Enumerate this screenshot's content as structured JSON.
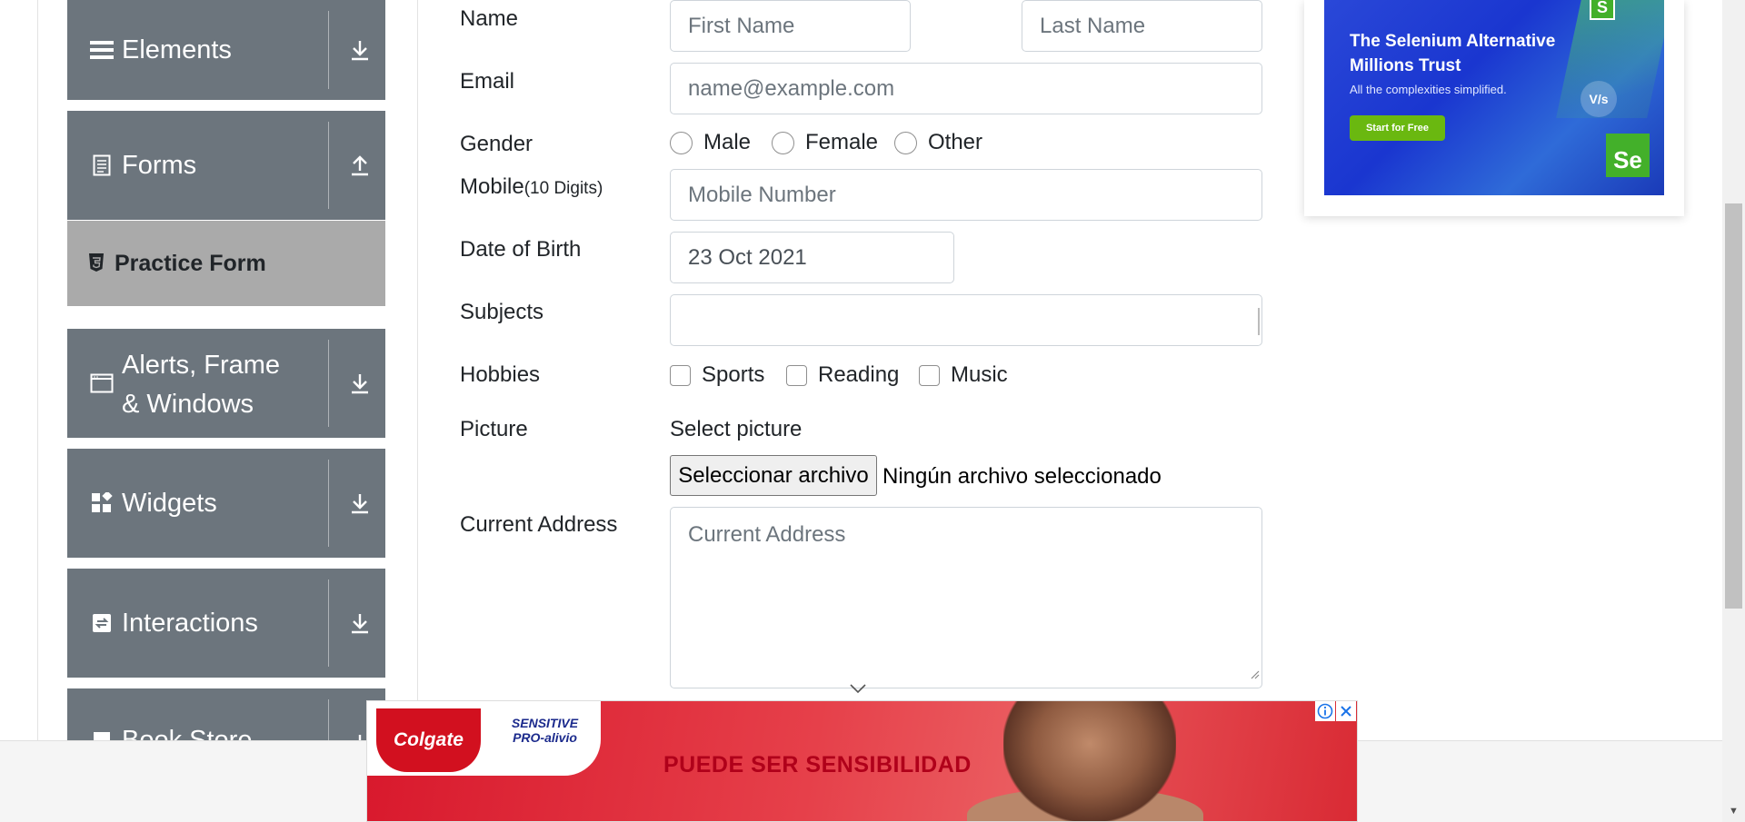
{
  "sidebar": {
    "groups": [
      {
        "label": "Elements",
        "icon": "hamburger-icon",
        "arrow": "download-arrow-icon"
      },
      {
        "label": "Forms",
        "icon": "document-icon",
        "arrow": "upload-arrow-icon"
      },
      {
        "label": "Alerts, Frame & Windows",
        "icon": "window-icon",
        "arrow": "download-arrow-icon"
      },
      {
        "label": "Widgets",
        "icon": "widgets-icon",
        "arrow": "download-arrow-icon"
      },
      {
        "label": "Interactions",
        "icon": "interactions-icon",
        "arrow": "download-arrow-icon"
      },
      {
        "label": "Book Store",
        "icon": "book-icon",
        "arrow": "download-arrow-icon"
      }
    ],
    "active_item": "Practice Form"
  },
  "form": {
    "name_label": "Name",
    "first_name_placeholder": "First Name",
    "last_name_placeholder": "Last Name",
    "email_label": "Email",
    "email_placeholder": "name@example.com",
    "gender_label": "Gender",
    "gender_options": [
      "Male",
      "Female",
      "Other"
    ],
    "mobile_label": "Mobile",
    "mobile_hint": "(10 Digits)",
    "mobile_placeholder": "Mobile Number",
    "dob_label": "Date of Birth",
    "dob_value": "23 Oct 2021",
    "subjects_label": "Subjects",
    "subjects_value": "",
    "hobbies_label": "Hobbies",
    "hobbies_options": [
      "Sports",
      "Reading",
      "Music"
    ],
    "picture_label": "Picture",
    "picture_prompt": "Select picture",
    "file_button": "Seleccionar archivo",
    "file_status": "Ningún archivo seleccionado",
    "address_label": "Current Address",
    "address_placeholder": "Current Address"
  },
  "ad_top": {
    "headline": "The Selenium Alternative Millions Trust",
    "subline": "All the complexities simplified.",
    "cta": "Start for Free",
    "badge": "Se",
    "vs": "V/s",
    "s_badge": "S"
  },
  "ad_bottom": {
    "brand": "Colgate",
    "product": "SENSITIVE PRO-alivio",
    "headline": "PUEDE SER SENSIBILIDAD"
  },
  "colors": {
    "sidebar_group": "#6c757d",
    "sidebar_active": "#aaaaaa",
    "input_border": "#ced4da",
    "ad_blue": "#1a36d0",
    "ad_red": "#d8182c"
  }
}
